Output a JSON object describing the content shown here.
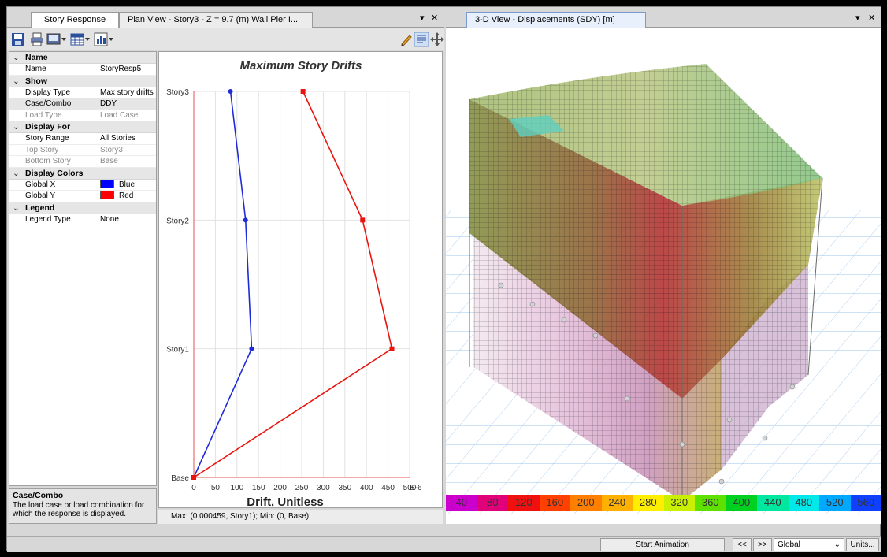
{
  "left_pane": {
    "tabs": [
      {
        "label": "Story Response"
      },
      {
        "label": "Plan View - Story3 - Z = 9.7 (m)  Wall Pier I..."
      }
    ],
    "pin_label": "▾",
    "close_label": "✕"
  },
  "properties": {
    "categories": [
      {
        "title": "Name",
        "rows": [
          {
            "k": "Name",
            "v": "StoryResp5"
          }
        ]
      },
      {
        "title": "Show",
        "rows": [
          {
            "k": "Display Type",
            "v": "Max story drifts"
          },
          {
            "k": "Case/Combo",
            "v": "DDY"
          },
          {
            "k": "Load Type",
            "v": "Load Case"
          }
        ]
      },
      {
        "title": "Display For",
        "rows": [
          {
            "k": "Story Range",
            "v": "All Stories"
          },
          {
            "k": "Top Story",
            "v": "Story3"
          },
          {
            "k": "Bottom Story",
            "v": "Base"
          }
        ]
      },
      {
        "title": "Display Colors",
        "rows": [
          {
            "k": "Global X",
            "v": "Blue"
          },
          {
            "k": "Global Y",
            "v": "Red"
          }
        ]
      },
      {
        "title": "Legend",
        "rows": [
          {
            "k": "Legend Type",
            "v": "None"
          }
        ]
      }
    ],
    "colors": {
      "global_x": "#0000ff",
      "global_y": "#ff0000"
    }
  },
  "description": {
    "title": "Case/Combo",
    "text": "The load case or load combination for which the response is displayed."
  },
  "chart_status": "Max: (0.000459, Story1);  Min: (0, Base)",
  "chart_data": {
    "type": "line",
    "title": "Maximum Story Drifts",
    "xlabel": "Drift, Unitless",
    "x_unit_suffix": "E-6",
    "categories": [
      "Base",
      "Story1",
      "Story2",
      "Story3"
    ],
    "xlim": [
      0,
      500
    ],
    "x_ticks": [
      0,
      50,
      100,
      150,
      200,
      250,
      300,
      350,
      400,
      450,
      500
    ],
    "grid": true,
    "series": [
      {
        "color": "#1f2bd6",
        "values": [
          0,
          134,
          120,
          85
        ]
      },
      {
        "color": "#e8140f",
        "values": [
          0,
          459,
          391,
          253
        ]
      }
    ]
  },
  "right_pane": {
    "tab_label": "3-D View  - Displacements (SDY)  [m]",
    "pin_label": "▾",
    "close_label": "✕"
  },
  "legend": {
    "labels": [
      "40",
      "80",
      "120",
      "160",
      "200",
      "240",
      "280",
      "320",
      "360",
      "400",
      "440",
      "480",
      "520",
      "560"
    ],
    "colors": [
      "#cc00cc",
      "#e0007a",
      "#f01010",
      "#ff4000",
      "#ff8000",
      "#ffb000",
      "#ffee00",
      "#c8f000",
      "#5ee000",
      "#00d020",
      "#00e8a0",
      "#00e8e8",
      "#00a8ff",
      "#1040ff"
    ]
  },
  "statusbar": {
    "start_animation": "Start Animation",
    "prev": "<<",
    "next": ">>",
    "coord_system": "Global",
    "units": "Units..."
  }
}
